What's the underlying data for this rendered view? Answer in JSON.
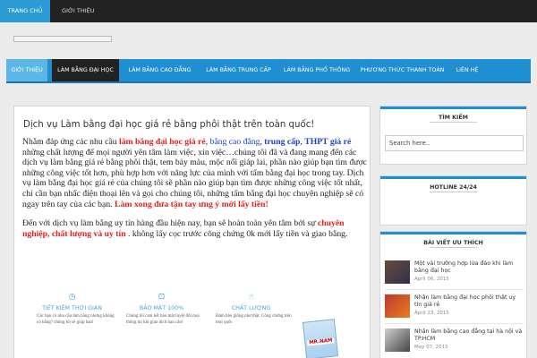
{
  "topbar": {
    "home": "TRANG CHỦ",
    "about": "GIỚI THIỆU"
  },
  "nav": [
    "GIỚI THIỆU",
    "LÀM BẰNG ĐẠI HỌC",
    "LÀM BẰNG CAO ĐẲNG",
    "LÀM BẰNG TRUNG CẤP",
    "LÀM BẰNG PHỔ THÔNG",
    "PHƯƠNG THỨC THANH TOÁN",
    "LIÊN HỆ"
  ],
  "post": {
    "title": "Dịch vụ Làm bằng đại học giá rẻ bằng phôi thật trên toàn quốc!",
    "p1": {
      "t1": "Nhằm đáp ứng các nhu cầu ",
      "h1": "làm bằng đại học giá rẻ",
      "t2": ", ",
      "l1": "bằng cao đẳng",
      "t3": ", ",
      "l2": "trung cấp",
      "t4": ", ",
      "l3": "THPT giá rẻ",
      "t5": " những chất lượng để mọi người yên tâm làm việc, xin việc…chúng tôi đã và đang mang đến các dịch vụ làm bằng giá rẻ bằng phôi thật, tem bảy màu, mộc nổi giáp lai, phần nào giúp bạn tìm được những công việc tốt hơn, phù hợp hơn với năng lực của mình với tấm bằng đại học trong tay. Dịch vụ làm bằng đại học giá rẻ của chúng tôi sẽ phần nào giúp bạn tìm được những công việc tốt nhất, chỉ cần bạn nhấc điện thoại lên và gọi cho chúng tôi, những tấm bằng đại học chuyên nghiệp sẽ có ngay trên tay của các bạn. ",
      "h2": "Làm xong đưa tận tay ưng ý mới lấy tiền!"
    },
    "p2": {
      "t1": "Đến với dịch vụ làm bằng uy tín hàng đầu hiện nay, bạn sẽ hoàn toàn yên tâm bởi sự ",
      "h1": "chuyên nghiệp, chất lượng và uy tín",
      "t2": " . không lấy cọc trước công chứng 0k mới lấy tiền và giao bằng."
    }
  },
  "features": [
    {
      "icon": "clock-icon",
      "title": "TIẾT KIỆM THỜI GIAN",
      "desc1": "Các bạn có nhu cầu làm bằng nhưng không có bằng? chúng tôi sẽ giúp bạn!"
    },
    {
      "icon": "lock-icon",
      "title": "BẢO MẬT 100%",
      "desc1": "Chúng tôi cam kết bảo mật tuyệt đối mọi thông tin khi giao dịch bạn cần!"
    },
    {
      "icon": "thumbs-up-icon",
      "title": "CHẤT LƯỢNG",
      "desc1": "Đảm bảo giống như thật. Công chứng trên mọi quốc"
    }
  ],
  "stamp_label": "MR.NAM",
  "sidebar": {
    "search_title": "TÌM KIẾM",
    "search_placeholder": "Search here..",
    "hotline_title": "HOTLINE 24/24",
    "featured_title": "BÀI VIẾT ƯU THÍCH",
    "posts": [
      {
        "title": "Một vài trường hợp lừa đảo khi làm bằng đại học",
        "date": "April 06, 2015"
      },
      {
        "title": "Nhận làm bằng đại học phôi thật uy tín giá rẻ",
        "date": "April 23, 2015"
      },
      {
        "title": "Nhận làm bằng cao đẳng tại hà nội và TP.HCM",
        "date": "May 07, 2015"
      }
    ]
  },
  "colors": {
    "accent": "#1f8fd1",
    "highlight": "#e02020",
    "link": "#1a3fcf"
  }
}
